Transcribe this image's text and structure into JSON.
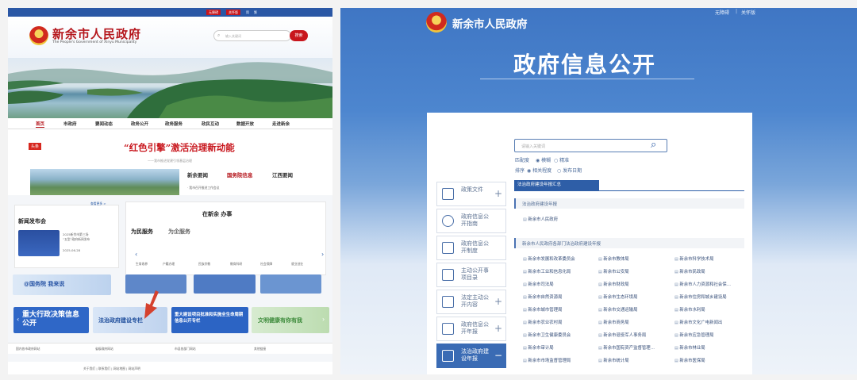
{
  "left": {
    "topbar_links": [
      "无障碍",
      "关怀版",
      "简",
      "繁"
    ],
    "topbar_red": [
      "无障碍",
      "关怀版"
    ],
    "logo_title": "新余市人民政府",
    "logo_subtitle": "The People's Government of Xinyu Municipality",
    "search_placeholder": "输入关键词",
    "search_button": "搜索",
    "nav": [
      "首页",
      "市政府",
      "要闻动态",
      "政务公开",
      "政务服务",
      "政民互动",
      "数据开放",
      "走进新余"
    ],
    "headline_tag": "头条",
    "headline": "“红色引擎”激活治理新动能",
    "headline_sub": "——我市推进党建引领基层治理",
    "news_tabs": [
      "新余要闻",
      "国务院信息",
      "江西要闻"
    ],
    "news_item": "· 我市召开推进工作会议",
    "more": "查看更多 >",
    "press_title": "新闻发布会",
    "press_item": "2025新余市第三场\n“五型”政府新闻发布",
    "press_date": "2025-06-28",
    "service_title": "在新余 办事",
    "service_tabs": [
      "为民服务",
      "为企服务"
    ],
    "service_icons": [
      "生育收养",
      "户籍办理",
      "民族宗教",
      "教育科研",
      "社会保障",
      "就业创业"
    ],
    "gov_banner": "@国务院 我来说",
    "promo": [
      "重大行政决策信息公开",
      "法治政府建设专栏",
      "重大建设项目批准和实施全生命周期信息公开专栏",
      "文明健康有你有我"
    ],
    "footer_links": [
      "国内各市政府网站",
      "省级政府网站",
      "市县各部门网站",
      "其他链接"
    ],
    "copyright": "关于我们 | 联系我们 | 网站地图 | 网站声明"
  },
  "right": {
    "title": "新余市人民政府",
    "top_links": [
      "无障碍",
      "关怀版"
    ],
    "big_title": "政府信息公开",
    "search_placeholder": "请输入关键词",
    "match_label": "匹配度",
    "match_opts": [
      "模糊",
      "精准"
    ],
    "sort_label": "排序",
    "sort_opts": [
      "相关程度",
      "发布日期"
    ],
    "side_nav": [
      {
        "label": "政策文件",
        "icon": "document-icon"
      },
      {
        "label": "政府信息公开指南",
        "icon": "compass-icon"
      },
      {
        "label": "政府信息公开制度",
        "icon": "list-icon"
      },
      {
        "label": "主动公开事项目录",
        "icon": "folder-icon"
      },
      {
        "label": "法定主动公开内容",
        "icon": "checklist-icon"
      },
      {
        "label": "政府信息公开年报",
        "icon": "report-icon"
      },
      {
        "label": "法治政府建设年报",
        "icon": "report-icon",
        "active": true
      }
    ],
    "tab_header": "法治政府建设年报汇总",
    "sec1": "法治政府建设年报",
    "sec1_items": [
      "新余市人民政府"
    ],
    "sec2": "新余市人民政府各部门法治政府建设年报",
    "sec2_items": [
      [
        "新余市发展和改革委员会",
        "新余市教体局",
        "新余市科学技术局"
      ],
      [
        "新余市工业和信息化局",
        "新余市公安局",
        "新余市民政局"
      ],
      [
        "新余市司法局",
        "新余市财政局",
        "新余市人力资源和社会保…"
      ],
      [
        "新余市自然资源局",
        "新余市生态环境局",
        "新余市住房和城乡建设局"
      ],
      [
        "新余市城市管理局",
        "新余市交通运输局",
        "新余市水利局"
      ],
      [
        "新余市农业农村局",
        "新余市商务局",
        "新余市文化广电新闻出"
      ],
      [
        "新余市卫生健康委员会",
        "新余市退役军人事务局",
        "新余市应急管理局"
      ],
      [
        "新余市审计局",
        "新余市国有资产监督管理…",
        "新余市林业局"
      ],
      [
        "新余市市场监督管理局",
        "新余市统计局",
        "新余市医保局"
      ]
    ]
  },
  "colors": {
    "red": "#c8161d",
    "blue": "#2e5ea7"
  }
}
